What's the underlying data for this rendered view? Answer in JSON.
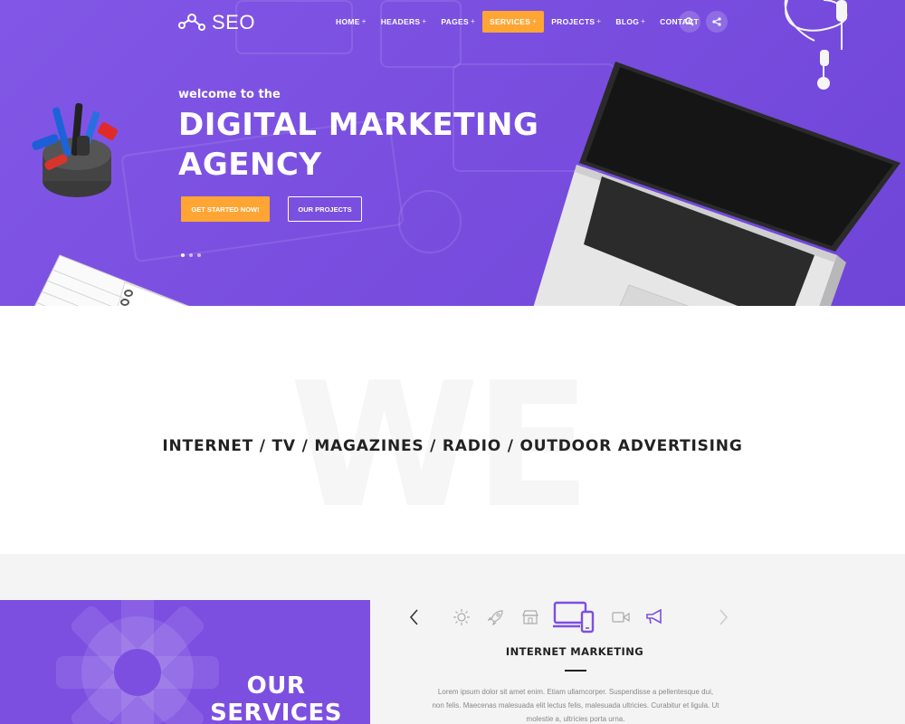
{
  "brand": {
    "name": "SEO"
  },
  "nav": {
    "items": [
      {
        "label": "HOME",
        "plus": "+"
      },
      {
        "label": "HEADERS",
        "plus": "+"
      },
      {
        "label": "PAGES",
        "plus": "+"
      },
      {
        "label": "SERVICES",
        "plus": "+",
        "active": true
      },
      {
        "label": "PROJECTS",
        "plus": "+"
      },
      {
        "label": "BLOG",
        "plus": "+"
      },
      {
        "label": "CONTACT",
        "plus": ""
      }
    ],
    "buttons": [
      "search-icon",
      "share-icon"
    ]
  },
  "hero": {
    "welcome": "welcome to the",
    "headline_line1": "DIGITAL MARKETING",
    "headline_line2": "AGENCY",
    "cta_primary": "GET STARTED NOW!",
    "cta_secondary": "OUR PROJECTS",
    "slider_dots": 3,
    "active_dot": 0
  },
  "we_section": {
    "watermark": "WE",
    "tagline": "INTERNET / TV / MAGAZINES / RADIO / OUTDOOR ADVERTISING"
  },
  "services": {
    "heading_line1": "OUR",
    "heading_line2": "SERVICES",
    "icons": [
      "sun-icon",
      "rocket-icon",
      "store-icon",
      "devices-icon",
      "video-camera-icon",
      "megaphone-icon"
    ],
    "active_icon": "devices-icon",
    "active_title": "INTERNET MARKETING",
    "description_line1": "Lorem ipsum dolor sit amet enim. Etiam ullamcorper. Suspendisse a pellentesque dui,",
    "description_line2": "non felis. Maecenas malesuada elit lectus felis, malesuada ultricies. Curabitur et ligula. Ut",
    "description_line3": "molestie a, ultricies porta urna."
  },
  "colors": {
    "purple": "#7c4fe1",
    "accent": "#ffa534",
    "text_dark": "#222222",
    "text_muted": "#888888"
  }
}
